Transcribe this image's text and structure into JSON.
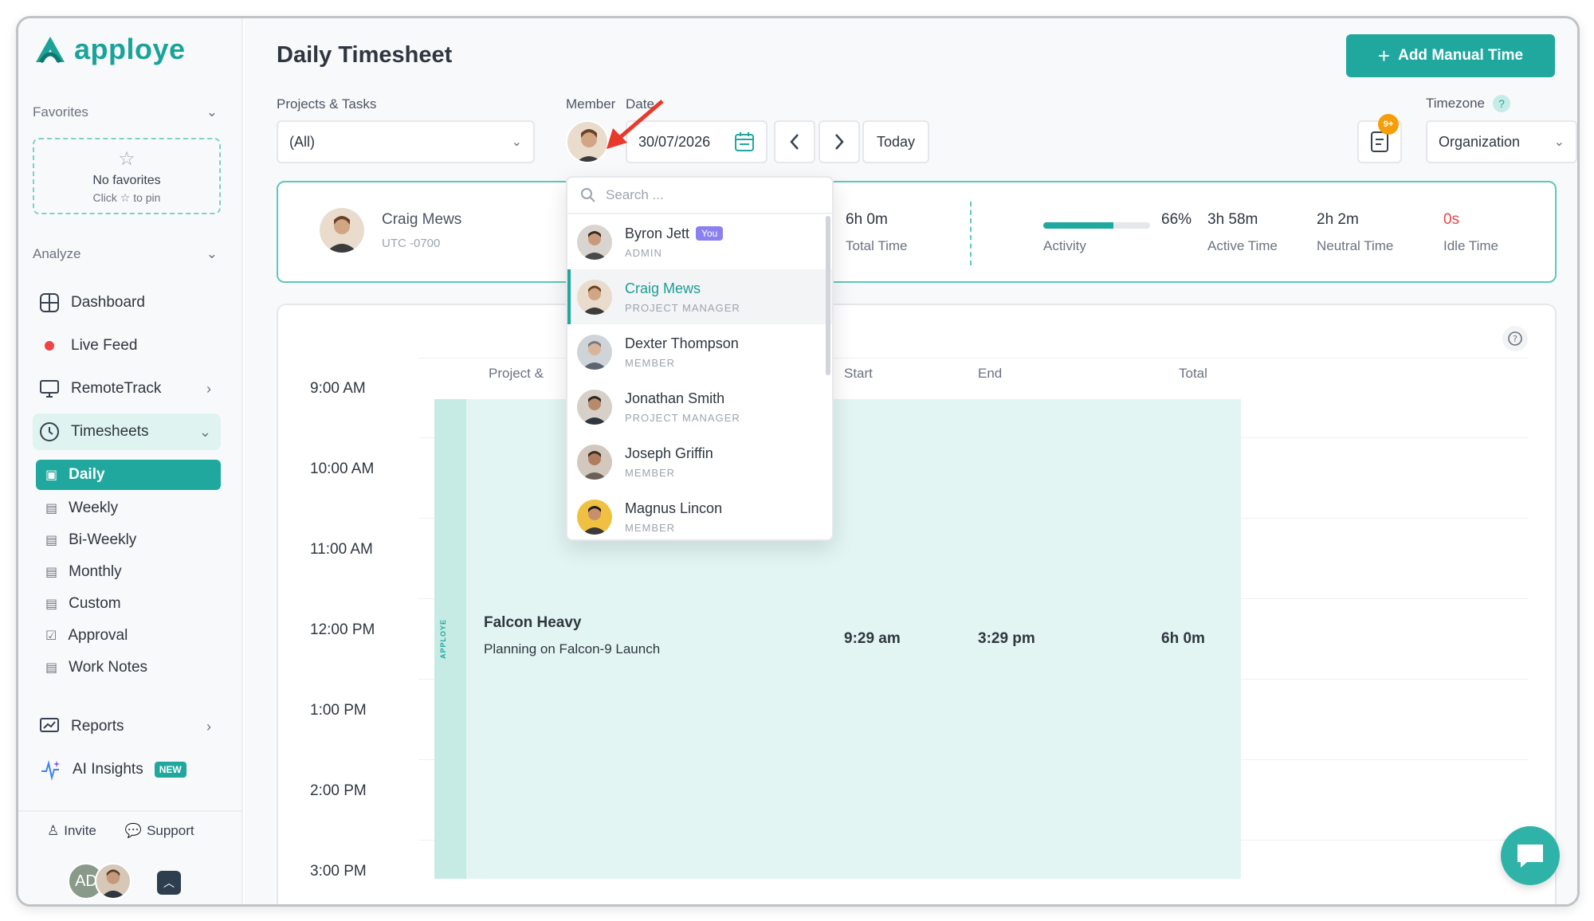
{
  "brand": {
    "name": "apploye",
    "accent": "#20a89f"
  },
  "sidebar": {
    "favorites_label": "Favorites",
    "favorites_empty_title": "No favorites",
    "favorites_empty_hint": "Click ☆ to pin",
    "analyze_label": "Analyze",
    "nav": [
      {
        "label": "Dashboard",
        "icon": "dashboard-icon"
      },
      {
        "label": "Live Feed",
        "icon": "live-dot-icon"
      },
      {
        "label": "RemoteTrack",
        "icon": "monitor-icon"
      },
      {
        "label": "Timesheets",
        "icon": "clock-icon"
      },
      {
        "label": "Reports",
        "icon": "report-icon"
      },
      {
        "label": "AI Insights",
        "icon": "sparkle-icon",
        "badge": "NEW"
      }
    ],
    "timesheet_sub": [
      "Daily",
      "Weekly",
      "Bi-Weekly",
      "Monthly",
      "Custom",
      "Approval",
      "Work Notes"
    ],
    "footer": {
      "invite": "Invite",
      "support": "Support",
      "user_initials": "AD"
    }
  },
  "header": {
    "title": "Daily Timesheet",
    "add_button": "Add Manual Time"
  },
  "filters": {
    "projects_label": "Projects & Tasks",
    "projects_value": "(All)",
    "member_label": "Member",
    "date_label": "Date",
    "date_value": "30/07/2026",
    "today_label": "Today",
    "notif_badge": "9+",
    "timezone_label": "Timezone",
    "timezone_value": "Organization"
  },
  "summary": {
    "name": "Craig Mews",
    "timezone": "UTC -0700",
    "total_time": "6h 0m",
    "total_time_label": "Total Time",
    "activity_pct": "66%",
    "activity_fraction": 0.66,
    "activity_label": "Activity",
    "active_time": "3h 58m",
    "active_time_label": "Active Time",
    "neutral_time": "2h 2m",
    "neutral_time_label": "Neutral Time",
    "idle_time": "0s",
    "idle_time_label": "Idle Time"
  },
  "timeline": {
    "columns": {
      "project": "Project &",
      "start": "Start",
      "end": "End",
      "total": "Total"
    },
    "hours": [
      "9:00 AM",
      "10:00 AM",
      "11:00 AM",
      "12:00 PM",
      "1:00 PM",
      "2:00 PM",
      "3:00 PM"
    ],
    "entry": {
      "strip_label": "APPLOYE",
      "project": "Falcon Heavy",
      "task": "Planning on Falcon-9 Launch",
      "start": "9:29 am",
      "end": "3:29 pm",
      "total": "6h 0m"
    }
  },
  "member_dropdown": {
    "search_placeholder": "Search ...",
    "members": [
      {
        "name": "Byron Jett",
        "role": "ADMIN",
        "you": "You"
      },
      {
        "name": "Craig Mews",
        "role": "PROJECT MANAGER"
      },
      {
        "name": "Dexter Thompson",
        "role": "MEMBER"
      },
      {
        "name": "Jonathan Smith",
        "role": "PROJECT MANAGER"
      },
      {
        "name": "Joseph Griffin",
        "role": "MEMBER"
      },
      {
        "name": "Magnus Lincon",
        "role": "MEMBER"
      }
    ]
  }
}
